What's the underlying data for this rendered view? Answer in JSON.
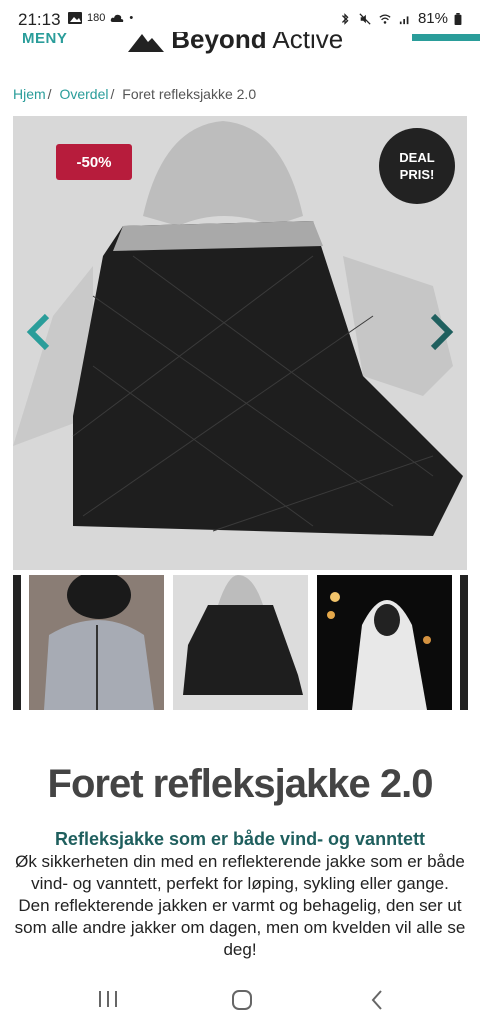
{
  "status_bar": {
    "time": "21:13",
    "badge": "180",
    "battery": "81%"
  },
  "header": {
    "menu_label": "MENY",
    "brand_name": "Beyond",
    "brand_suffix": "Active"
  },
  "breadcrumb": {
    "home": "Hjem",
    "category": "Overdel",
    "current": "Foret refleksjakke 2.0",
    "separator": "/"
  },
  "hero": {
    "sale_badge": "-50%",
    "deal_line1": "DEAL",
    "deal_line2": "PRIS!"
  },
  "product": {
    "title": "Foret refleksjakke 2.0",
    "subtitle": "Refleksjakke som er både vind- og vanntett",
    "description": "Øk sikkerheten din med en reflekterende jakke som er både vind- og vanntett, perfekt for løping, sykling eller gange. Den reflekterende jakken er varmt og behagelig, den ser ut som alle andre jakker om dagen, men om kvelden vil alle se deg!"
  },
  "colors": {
    "accent": "#2a9d9a",
    "sale": "#b71c3c",
    "deal": "#222222",
    "title": "#444444",
    "subtitle": "#1f5f5e"
  }
}
